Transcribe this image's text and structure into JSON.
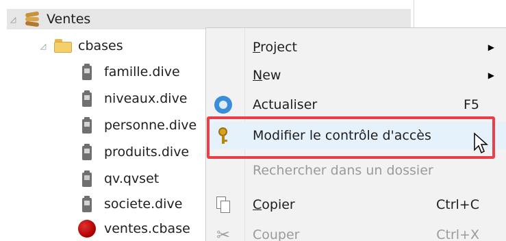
{
  "tree": {
    "root": {
      "expander": "◿",
      "label": "Ventes",
      "icon": "database-stack-icon"
    },
    "folder": {
      "expander": "◿",
      "label": "cbases",
      "icon": "folder-icon"
    },
    "files": [
      {
        "label": "famille.dive",
        "icon": "dive-file-icon"
      },
      {
        "label": "niveaux.dive",
        "icon": "dive-file-icon"
      },
      {
        "label": "personne.dive",
        "icon": "dive-file-icon"
      },
      {
        "label": "produits.dive",
        "icon": "dive-file-icon"
      },
      {
        "label": "qv.qvset",
        "icon": "qvset-file-icon"
      },
      {
        "label": "societe.dive",
        "icon": "dive-file-icon"
      },
      {
        "label": "ventes.cbase",
        "icon": "cube-icon"
      }
    ]
  },
  "context_menu": {
    "items": [
      {
        "label": "Project",
        "accel": "P",
        "rest": "roject",
        "submenu": true
      },
      {
        "label": "New",
        "accel": "N",
        "rest": "ew",
        "submenu": true
      },
      {
        "label": "Actualiser",
        "shortcut": "F5",
        "icon": "refresh-icon"
      },
      {
        "label": "Modifier le contrôle d'accès",
        "icon": "key-icon",
        "highlighted": true
      },
      {
        "label": "Rechercher dans un dossier",
        "disabled": true
      },
      {
        "label": "Copier",
        "accel": "C",
        "rest": "opier",
        "shortcut": "Ctrl+C",
        "icon": "copy-icon"
      },
      {
        "label": "Couper",
        "shortcut": "Ctrl+X",
        "icon": "scissors-icon",
        "disabled": true
      }
    ],
    "submenu_arrow": "▶"
  },
  "colors": {
    "highlight_border": "#e8404b",
    "menu_background": "#f2f2f2",
    "selected_row": "#e6e6e6"
  }
}
